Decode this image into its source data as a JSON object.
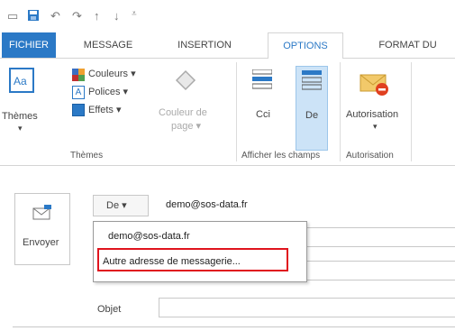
{
  "tabs": {
    "file": "FICHIER",
    "message": "MESSAGE",
    "insertion": "INSERTION",
    "options": "OPTIONS",
    "format": "FORMAT DU"
  },
  "ribbon": {
    "themes_label": "Thèmes",
    "couleurs": "Couleurs ▾",
    "polices": "Polices ▾",
    "effets": "Effets ▾",
    "couleur_de_page_line1": "Couleur de",
    "couleur_de_page_line2": "page ▾",
    "cci": "Cci",
    "de": "De",
    "autorisation": "Autorisation",
    "group_themes": "Thèmes",
    "group_afficher": "Afficher les champs",
    "group_autorisation": "Autorisation",
    "accent": "#2b79c6"
  },
  "form": {
    "de_button": "De ▾",
    "from_value": "demo@sos-data.fr",
    "send_label": "Envoyer",
    "objet_label": "Objet"
  },
  "dropdown": {
    "items": [
      "demo@sos-data.fr",
      "Autre adresse de messagerie..."
    ]
  }
}
